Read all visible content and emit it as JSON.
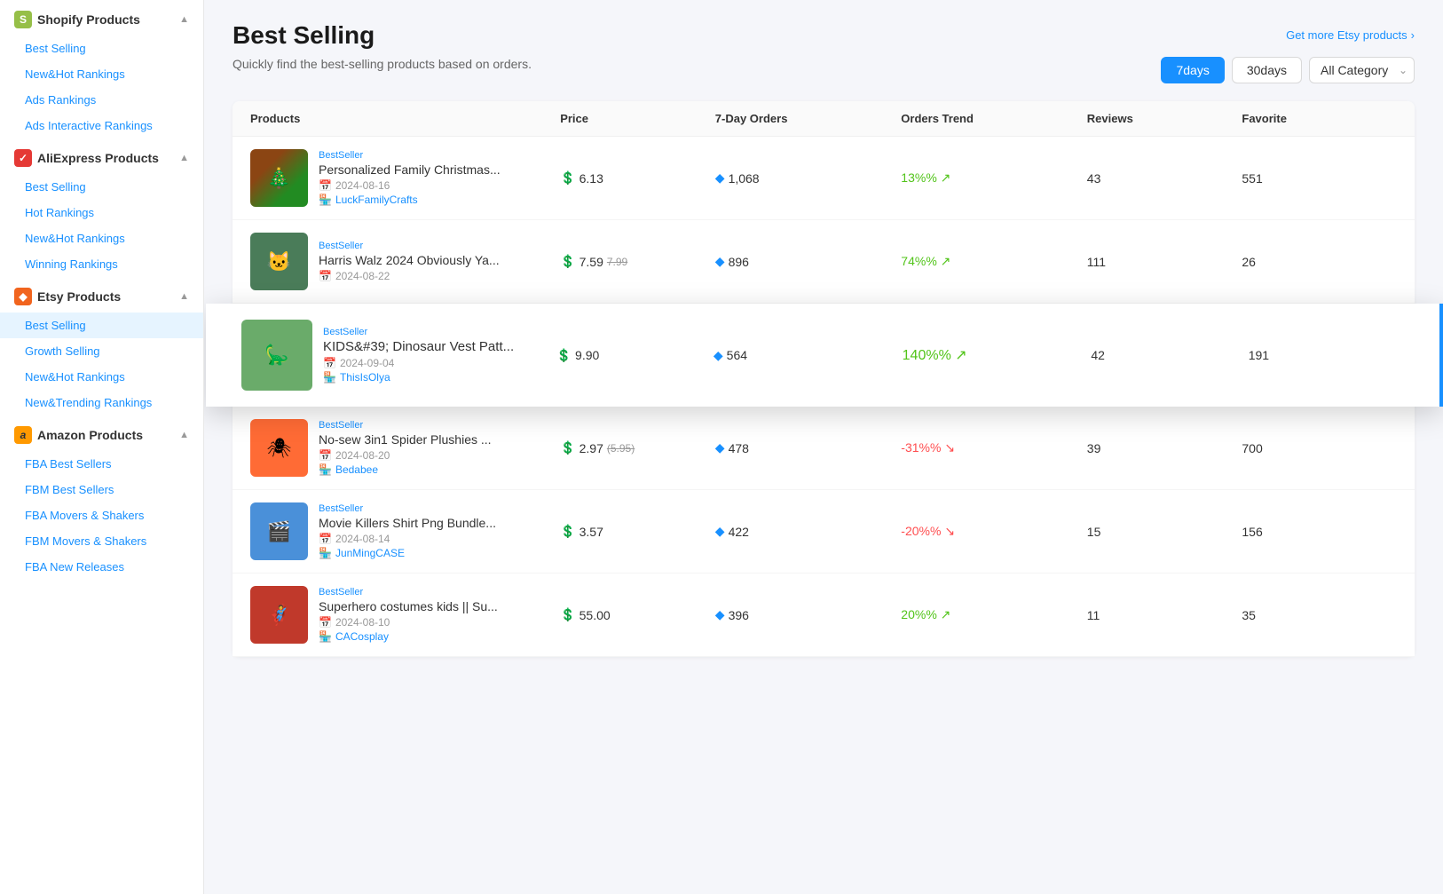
{
  "sidebar": {
    "shopify": {
      "title": "Shopify Products",
      "icon": "S",
      "items": [
        {
          "label": "Best Selling",
          "active": false
        },
        {
          "label": "New&Hot Rankings",
          "active": false
        },
        {
          "label": "Ads Rankings",
          "active": false
        },
        {
          "label": "Ads Interactive Rankings",
          "active": false
        }
      ]
    },
    "aliexpress": {
      "title": "AliExpress Products",
      "icon": "A",
      "items": [
        {
          "label": "Best Selling",
          "active": false
        },
        {
          "label": "Hot Rankings",
          "active": false
        },
        {
          "label": "New&Hot Rankings",
          "active": false
        },
        {
          "label": "Winning Rankings",
          "active": false
        }
      ]
    },
    "etsy": {
      "title": "Etsy Products",
      "icon": "E",
      "items": [
        {
          "label": "Best Selling",
          "active": true
        },
        {
          "label": "Growth Selling",
          "active": false
        },
        {
          "label": "New&Hot Rankings",
          "active": false
        },
        {
          "label": "New&Trending Rankings",
          "active": false
        }
      ]
    },
    "amazon": {
      "title": "Amazon Products",
      "icon": "a",
      "items": [
        {
          "label": "FBA Best Sellers",
          "active": false
        },
        {
          "label": "FBM Best Sellers",
          "active": false
        },
        {
          "label": "FBA Movers & Shakers",
          "active": false
        },
        {
          "label": "FBM Movers & Shakers",
          "active": false
        },
        {
          "label": "FBA New Releases",
          "active": false
        }
      ]
    }
  },
  "page": {
    "title": "Best Selling",
    "subtitle": "Quickly find the best-selling products based on orders.",
    "etsy_link": "Get more Etsy products",
    "filters": {
      "days7": "7days",
      "days30": "30days",
      "category": "All Category"
    }
  },
  "table": {
    "headers": [
      "Products",
      "Price",
      "7-Day Orders",
      "Orders Trend",
      "Reviews",
      "Favorite"
    ],
    "rows": [
      {
        "badge": "BestSeller",
        "name": "Personalized Family Christmas...",
        "date": "2024-08-16",
        "seller": "LuckFamilyCrafts",
        "price": "6.13",
        "price_original": null,
        "orders": "1,068",
        "trend": "13%",
        "trend_up": true,
        "reviews": "43",
        "favorite": "551",
        "img_color": "christmas",
        "highlighted": false
      },
      {
        "badge": "BestSeller",
        "name": "Harris Walz 2024 Obviously Ya...",
        "date": "2024-08-22",
        "seller": null,
        "price": "7.59",
        "price_original": "7.99",
        "orders": "896",
        "trend": "74%",
        "trend_up": true,
        "reviews": "111",
        "favorite": "26",
        "img_color": "walz",
        "highlighted": false
      },
      {
        "badge": "BestSeller",
        "name": "KIDS&#39; Dinosaur Vest Patt...",
        "date": "2024-09-04",
        "seller": "ThisIsOlya",
        "price": "9.90",
        "price_original": null,
        "orders": "564",
        "trend": "140%",
        "trend_up": true,
        "reviews": "42",
        "favorite": "191",
        "img_color": "dino",
        "highlighted": true
      },
      {
        "badge": "BestSeller",
        "name": "No-sew 3in1 Spider Plushies ...",
        "date": "2024-08-20",
        "seller": "Bedabee",
        "price": "2.97",
        "price_original": "5.95",
        "orders": "478",
        "trend": "-31%",
        "trend_up": false,
        "reviews": "39",
        "favorite": "700",
        "img_color": "spider",
        "highlighted": false
      },
      {
        "badge": "BestSeller",
        "name": "Movie Killers Shirt Png Bundle...",
        "date": "2024-08-14",
        "seller": "JunMingCASE",
        "price": "3.57",
        "price_original": null,
        "orders": "422",
        "trend": "-20%",
        "trend_up": false,
        "reviews": "15",
        "favorite": "156",
        "img_color": "movie",
        "highlighted": false
      },
      {
        "badge": "BestSeller",
        "name": "Superhero costumes kids || Su...",
        "date": "2024-08-10",
        "seller": "CACosplay",
        "price": "55.00",
        "price_original": null,
        "orders": "396",
        "trend": "20%",
        "trend_up": true,
        "reviews": "11",
        "favorite": "35",
        "img_color": "superhero",
        "highlighted": false
      }
    ]
  },
  "icons": {
    "calendar": "📅",
    "store": "🏪",
    "diamond": "◆",
    "dollar": "$",
    "arrow_up": "↗",
    "arrow_down": "↘"
  }
}
